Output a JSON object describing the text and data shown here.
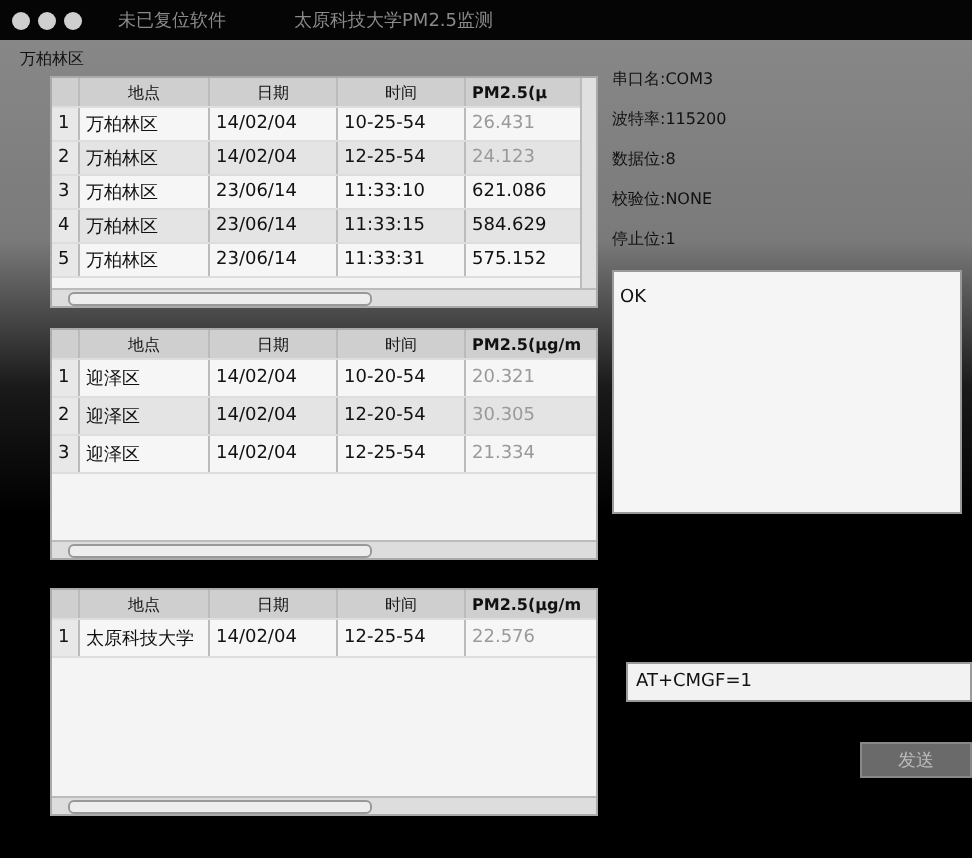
{
  "window": {
    "title": "未已复位软件",
    "subtitle": "太原科技大学PM2.5监测"
  },
  "section_label": "万柏林区",
  "tables": [
    {
      "columns": [
        "地点",
        "日期",
        "时间",
        "PM2.5(μ"
      ],
      "vertical_scrollbar": true,
      "rows": [
        {
          "index": "1",
          "cells": [
            "万柏林区",
            "14/02/04",
            "10-25-54",
            "26.431"
          ],
          "muted": true
        },
        {
          "index": "2",
          "cells": [
            "万柏林区",
            "14/02/04",
            "12-25-54",
            "24.123"
          ],
          "muted": true
        },
        {
          "index": "3",
          "cells": [
            "万柏林区",
            "23/06/14",
            "11:33:10",
            "621.086"
          ],
          "muted": false
        },
        {
          "index": "4",
          "cells": [
            "万柏林区",
            "23/06/14",
            "11:33:15",
            "584.629"
          ],
          "muted": false
        },
        {
          "index": "5",
          "cells": [
            "万柏林区",
            "23/06/14",
            "11:33:31",
            "575.152"
          ],
          "muted": false
        }
      ]
    },
    {
      "columns": [
        "地点",
        "日期",
        "时间",
        "PM2.5(μg/m"
      ],
      "vertical_scrollbar": false,
      "rows": [
        {
          "index": "1",
          "cells": [
            "迎泽区",
            "14/02/04",
            "10-20-54",
            "20.321"
          ],
          "muted": true
        },
        {
          "index": "2",
          "cells": [
            "迎泽区",
            "14/02/04",
            "12-20-54",
            "30.305"
          ],
          "muted": true
        },
        {
          "index": "3",
          "cells": [
            "迎泽区",
            "14/02/04",
            "12-25-54",
            "21.334"
          ],
          "muted": true
        }
      ]
    },
    {
      "columns": [
        "地点",
        "日期",
        "时间",
        "PM2.5(μg/m"
      ],
      "vertical_scrollbar": false,
      "rows": [
        {
          "index": "1",
          "cells": [
            "太原科技大学",
            "14/02/04",
            "12-25-54",
            "22.576"
          ],
          "muted": true
        }
      ]
    }
  ],
  "settings": [
    "串口名:COM3",
    "波特率:115200",
    "数据位:8",
    "校验位:NONE",
    "停止位:1"
  ],
  "output": {
    "value": "OK"
  },
  "command": {
    "value": "AT+CMGF=1"
  },
  "send_button": "发送"
}
